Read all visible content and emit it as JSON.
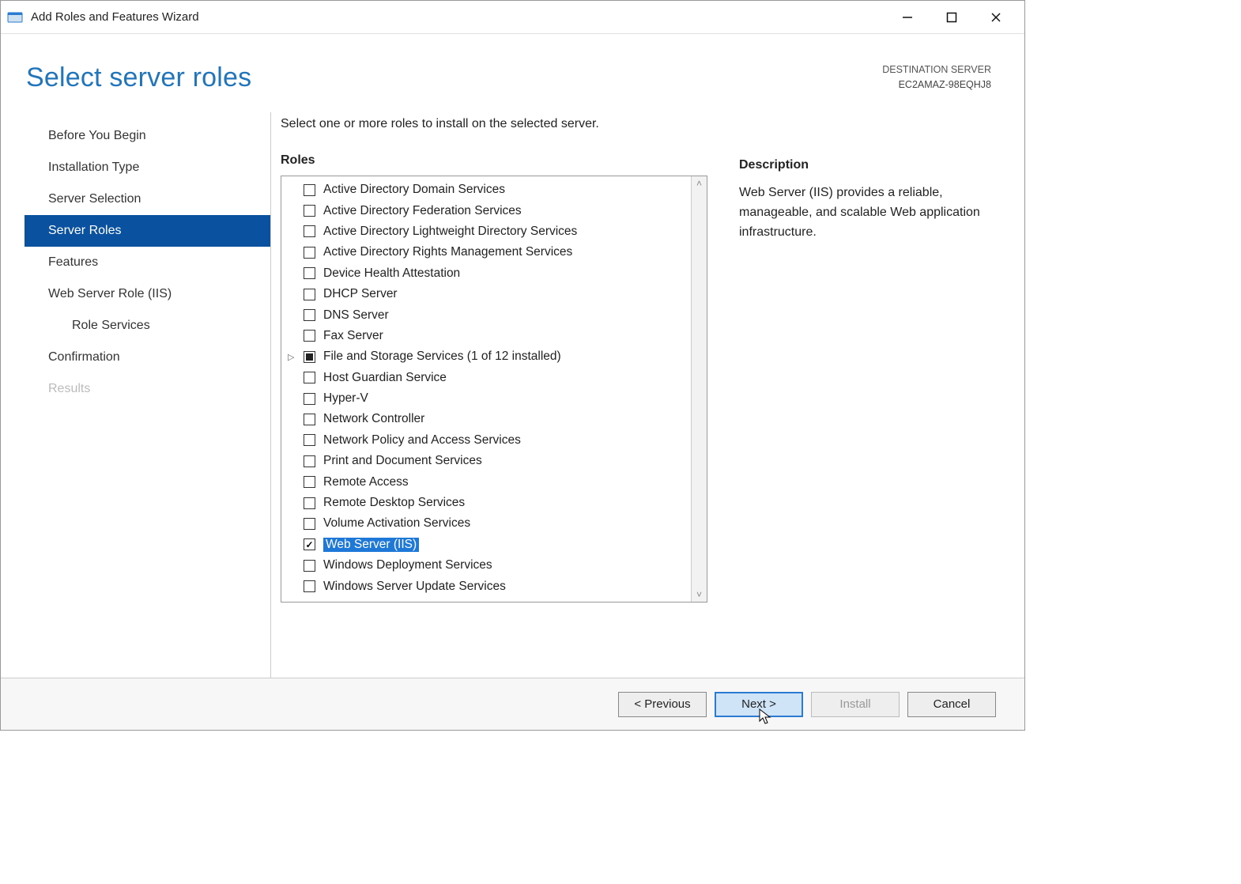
{
  "window": {
    "title": "Add Roles and Features Wizard"
  },
  "header": {
    "page_title": "Select server roles",
    "destination_label": "DESTINATION SERVER",
    "destination_server": "EC2AMAZ-98EQHJ8"
  },
  "nav": {
    "items": [
      {
        "label": "Before You Begin",
        "active": false,
        "indent": false,
        "disabled": false
      },
      {
        "label": "Installation Type",
        "active": false,
        "indent": false,
        "disabled": false
      },
      {
        "label": "Server Selection",
        "active": false,
        "indent": false,
        "disabled": false
      },
      {
        "label": "Server Roles",
        "active": true,
        "indent": false,
        "disabled": false
      },
      {
        "label": "Features",
        "active": false,
        "indent": false,
        "disabled": false
      },
      {
        "label": "Web Server Role (IIS)",
        "active": false,
        "indent": false,
        "disabled": false
      },
      {
        "label": "Role Services",
        "active": false,
        "indent": true,
        "disabled": false
      },
      {
        "label": "Confirmation",
        "active": false,
        "indent": false,
        "disabled": false
      },
      {
        "label": "Results",
        "active": false,
        "indent": false,
        "disabled": true
      }
    ]
  },
  "content": {
    "instruction": "Select one or more roles to install on the selected server.",
    "roles_label": "Roles",
    "roles": [
      {
        "label": "Active Directory Domain Services",
        "state": "unchecked",
        "expandable": false,
        "selected": false
      },
      {
        "label": "Active Directory Federation Services",
        "state": "unchecked",
        "expandable": false,
        "selected": false
      },
      {
        "label": "Active Directory Lightweight Directory Services",
        "state": "unchecked",
        "expandable": false,
        "selected": false
      },
      {
        "label": "Active Directory Rights Management Services",
        "state": "unchecked",
        "expandable": false,
        "selected": false
      },
      {
        "label": "Device Health Attestation",
        "state": "unchecked",
        "expandable": false,
        "selected": false
      },
      {
        "label": "DHCP Server",
        "state": "unchecked",
        "expandable": false,
        "selected": false
      },
      {
        "label": "DNS Server",
        "state": "unchecked",
        "expandable": false,
        "selected": false
      },
      {
        "label": "Fax Server",
        "state": "unchecked",
        "expandable": false,
        "selected": false
      },
      {
        "label": "File and Storage Services (1 of 12 installed)",
        "state": "partial",
        "expandable": true,
        "selected": false
      },
      {
        "label": "Host Guardian Service",
        "state": "unchecked",
        "expandable": false,
        "selected": false
      },
      {
        "label": "Hyper-V",
        "state": "unchecked",
        "expandable": false,
        "selected": false
      },
      {
        "label": "Network Controller",
        "state": "unchecked",
        "expandable": false,
        "selected": false
      },
      {
        "label": "Network Policy and Access Services",
        "state": "unchecked",
        "expandable": false,
        "selected": false
      },
      {
        "label": "Print and Document Services",
        "state": "unchecked",
        "expandable": false,
        "selected": false
      },
      {
        "label": "Remote Access",
        "state": "unchecked",
        "expandable": false,
        "selected": false
      },
      {
        "label": "Remote Desktop Services",
        "state": "unchecked",
        "expandable": false,
        "selected": false
      },
      {
        "label": "Volume Activation Services",
        "state": "unchecked",
        "expandable": false,
        "selected": false
      },
      {
        "label": "Web Server (IIS)",
        "state": "checked",
        "expandable": false,
        "selected": true
      },
      {
        "label": "Windows Deployment Services",
        "state": "unchecked",
        "expandable": false,
        "selected": false
      },
      {
        "label": "Windows Server Update Services",
        "state": "unchecked",
        "expandable": false,
        "selected": false
      }
    ],
    "description_label": "Description",
    "description_text": "Web Server (IIS) provides a reliable, manageable, and scalable Web application infrastructure."
  },
  "footer": {
    "previous": "< Previous",
    "next": "Next >",
    "install": "Install",
    "cancel": "Cancel"
  }
}
